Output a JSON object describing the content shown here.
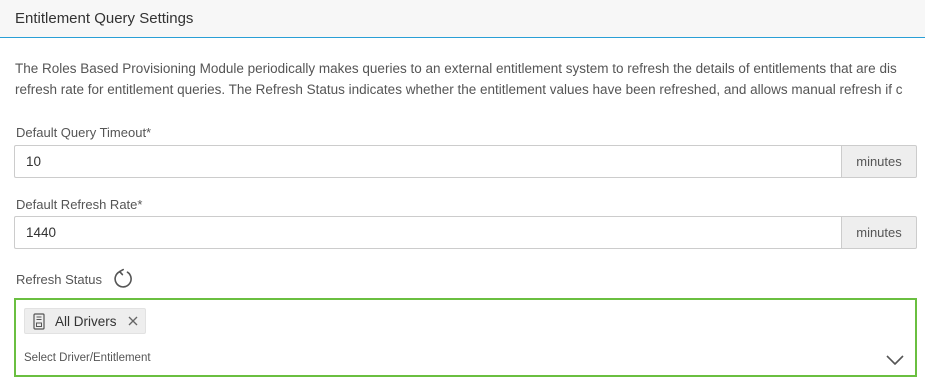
{
  "panel": {
    "title": "Entitlement Query Settings"
  },
  "description": {
    "line1": "The Roles Based Provisioning Module periodically makes queries to an external entitlement system to refresh the details of entitlements that are dis",
    "line2": "refresh rate for entitlement queries. The Refresh Status indicates whether the entitlement values have been refreshed, and allows manual refresh if c"
  },
  "query_timeout": {
    "label": "Default Query Timeout*",
    "value": "10",
    "unit": "minutes"
  },
  "refresh_rate": {
    "label": "Default Refresh Rate*",
    "value": "1440",
    "unit": "minutes"
  },
  "refresh_status": {
    "label": "Refresh Status",
    "icon": "refresh-icon",
    "chips": [
      {
        "label": "All Drivers",
        "icon": "driver-icon"
      }
    ],
    "placeholder": "Select Driver/Entitlement"
  },
  "colors": {
    "accent": "#2a9fd6",
    "focus_border": "#6abf40"
  }
}
